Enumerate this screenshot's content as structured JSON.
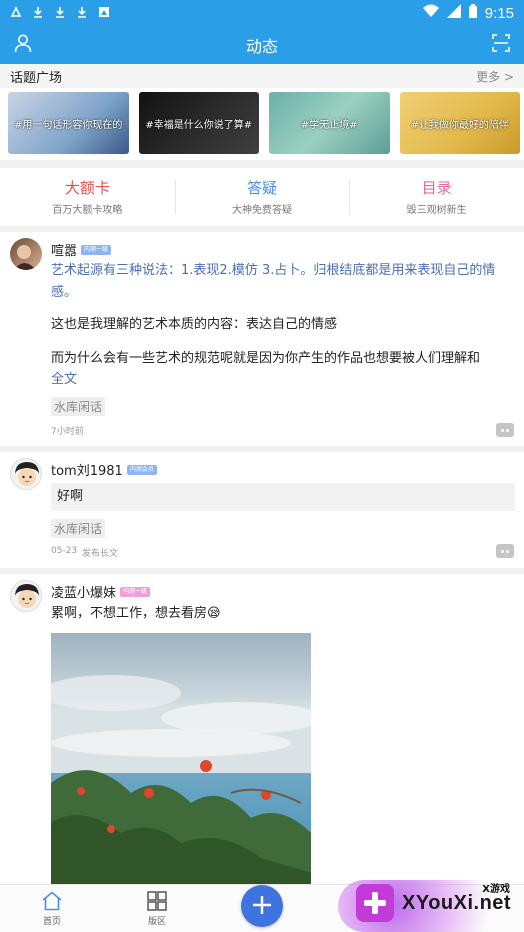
{
  "status_bar": {
    "time": "9:15",
    "left_icons": [
      "app-notification-icon",
      "download-icon",
      "download-icon",
      "download-icon",
      "image-icon"
    ],
    "right_icons": [
      "wifi-icon",
      "signal-icon",
      "battery-icon"
    ]
  },
  "app_bar": {
    "title": "动态",
    "left_icon": "user-icon",
    "right_icon": "scan-icon"
  },
  "topic_square": {
    "title": "话题广场",
    "more": "更多 >",
    "topics": [
      {
        "label": "#用一句话形容你现在的"
      },
      {
        "label": "#幸福是什么你说了算#"
      },
      {
        "label": "#学无止境#"
      },
      {
        "label": "#让我做你最好的陪伴"
      }
    ]
  },
  "quick_links": [
    {
      "title": "大额卡",
      "subtitle": "百万大额卡攻略",
      "color": "#e2534a"
    },
    {
      "title": "答疑",
      "subtitle": "大神免费答疑",
      "color": "#4a8fe0"
    },
    {
      "title": "目录",
      "subtitle": "毁三观树新生",
      "color": "#e86aa0"
    }
  ],
  "posts": [
    {
      "username": "喧嚣",
      "badge": "内测一级",
      "badge_color": "#8fb5f0",
      "highlight": "艺术起源有三种说法：1.表现2.模仿 3.占卜。归根结底都是用来表现自己的情感。",
      "paragraph1": "这也是我理解的艺术本质的内容：表达自己的情感",
      "paragraph2": "而为什么会有一些艺术的规范呢就是因为你产生的作品也想要被人们理解和",
      "full_text_link": "全文",
      "tag": "水库闲话",
      "time": "7小时前"
    },
    {
      "username": "tom刘1981",
      "badge": "内测会员",
      "badge_color": "#8fb5f0",
      "quote": "好啊",
      "tag": "水库闲话",
      "time": "05-23",
      "action": "发布长文"
    },
    {
      "username": "凌蓝小爆妹",
      "badge": "内测一级",
      "badge_color": "#f0a0d8",
      "text": "累啊，不想工作，想去看房😪"
    }
  ],
  "bottom_nav": {
    "home": "首页",
    "board": "版区",
    "add_icon": "plus-icon"
  },
  "watermark": {
    "small": "X游戏",
    "big": "XYouXi.net"
  }
}
